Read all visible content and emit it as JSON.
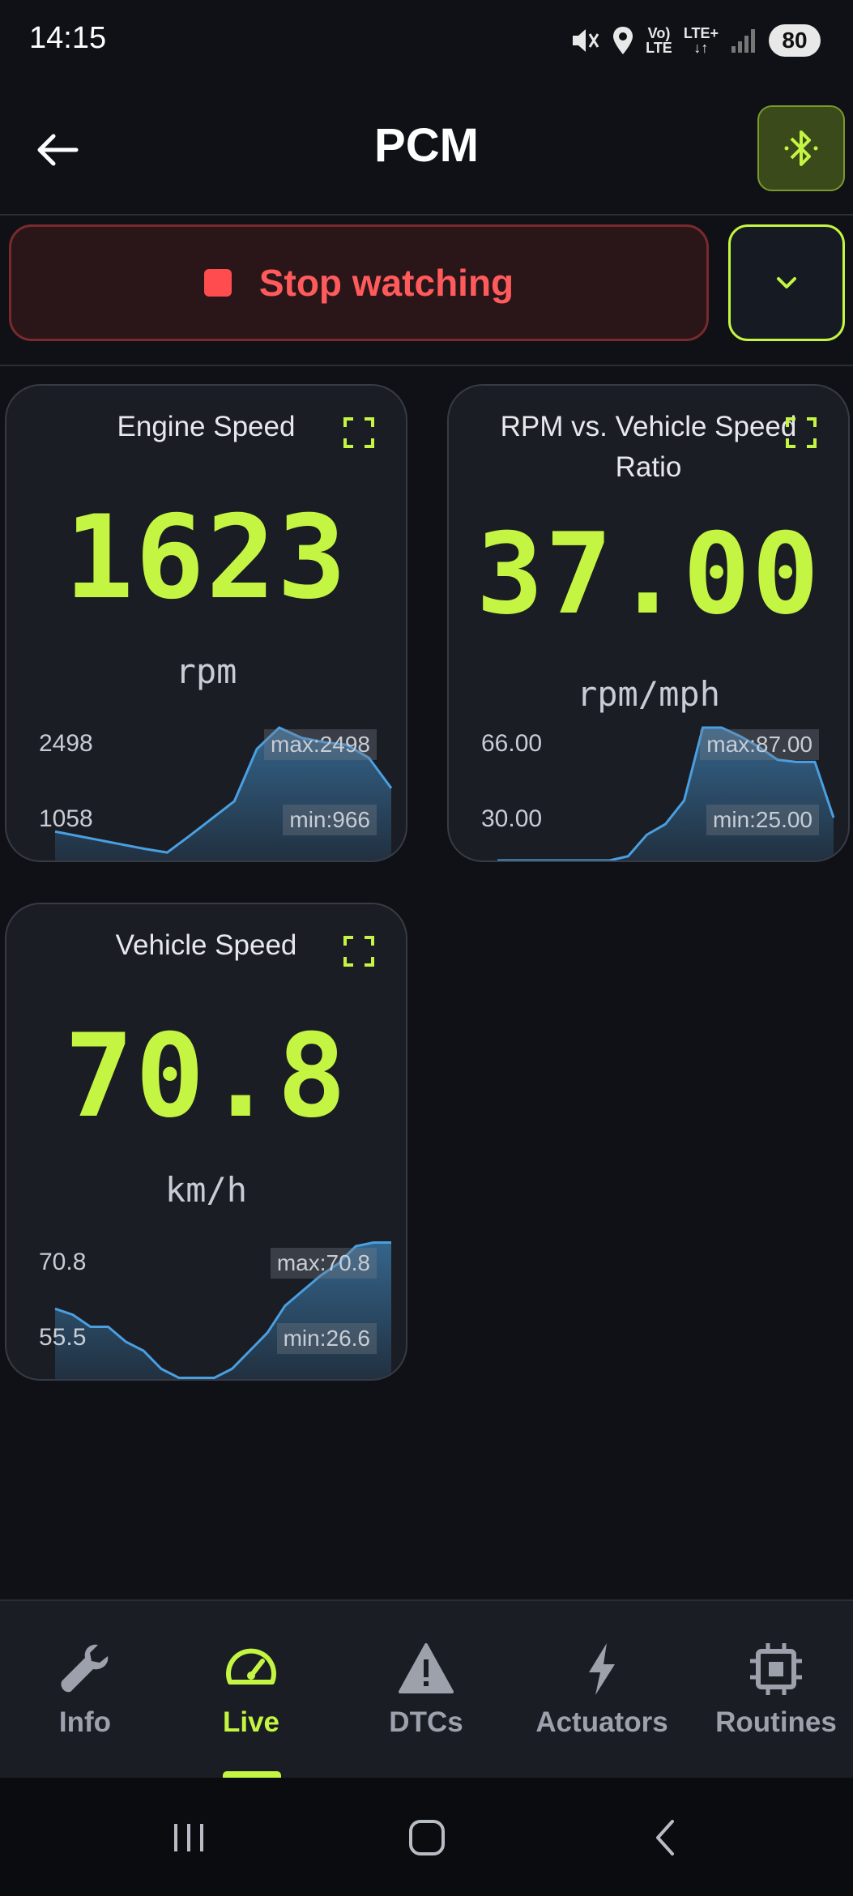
{
  "status_bar": {
    "time": "14:15",
    "lte_top": "Vo)",
    "lte_bottom": "LTE",
    "lte_plus": "LTE+",
    "battery": "80"
  },
  "header": {
    "title": "PCM",
    "back_icon": "arrow-left-icon",
    "bluetooth_icon": "bluetooth-icon"
  },
  "controls": {
    "stop_label": "Stop watching",
    "dropdown_icon": "chevron-down-icon"
  },
  "cards": [
    {
      "title": "Engine Speed",
      "value": "1623",
      "unit": "rpm",
      "axis_high": "2498",
      "axis_low": "1058",
      "max_label": "max:2498",
      "min_label": "min:966"
    },
    {
      "title": "RPM vs. Vehicle Speed Ratio",
      "value": "37.00",
      "unit": "rpm/mph",
      "axis_high": "66.00",
      "axis_low": "30.00",
      "max_label": "max:87.00",
      "min_label": "min:25.00"
    },
    {
      "title": "Vehicle Speed",
      "value": "70.8",
      "unit": "km/h",
      "axis_high": "70.8",
      "axis_low": "55.5",
      "max_label": "max:70.8",
      "min_label": "min:26.6"
    }
  ],
  "sparklines": [
    {
      "y_min": 966,
      "y_max": 2498,
      "values": [
        1300,
        1250,
        1200,
        1150,
        1100,
        1058,
        1250,
        1450,
        1650,
        2250,
        2498,
        2380,
        2330,
        2300,
        2150,
        1800
      ]
    },
    {
      "y_min": 25,
      "y_max": 87,
      "values": [
        25,
        25,
        25,
        25,
        25,
        25,
        25,
        27,
        37,
        42,
        53,
        87,
        87,
        83,
        78,
        72,
        71,
        71,
        45
      ]
    },
    {
      "y_min": 26.6,
      "y_max": 70.8,
      "values": [
        50,
        48,
        44,
        44,
        39,
        36,
        30,
        27,
        27,
        27,
        30,
        36,
        42,
        51,
        56,
        61,
        65,
        70.8,
        72,
        72
      ]
    }
  ],
  "bottom_nav": {
    "items": [
      {
        "label": "Info",
        "icon": "wrench-icon",
        "active": false
      },
      {
        "label": "Live",
        "icon": "gauge-icon",
        "active": true
      },
      {
        "label": "DTCs",
        "icon": "warning-triangle-icon",
        "active": false
      },
      {
        "label": "Actuators",
        "icon": "lightning-icon",
        "active": false
      },
      {
        "label": "Routines",
        "icon": "chip-icon",
        "active": false
      }
    ]
  },
  "system_nav": {
    "recents_icon": "recents-icon",
    "home_icon": "home-icon",
    "back_icon": "system-back-icon"
  },
  "colors": {
    "accent": "#c4f542",
    "stop_red": "#ff5a5c",
    "chart_line": "#4a9fe0",
    "background": "#0f1117",
    "card": "#1a1d24"
  }
}
